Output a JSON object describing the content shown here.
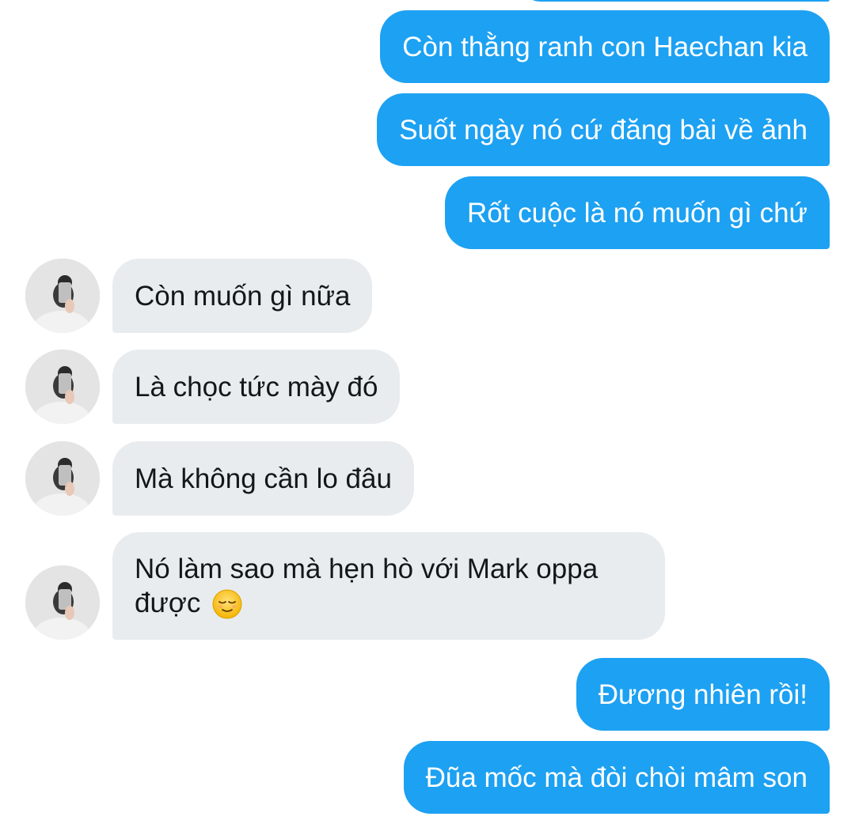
{
  "conversation": {
    "sent": [
      {
        "text": "Còn thằng ranh con Haechan kia"
      },
      {
        "text": "Suốt ngày nó cứ đăng bài về ảnh"
      },
      {
        "text": "Rốt cuộc là nó muốn gì chứ"
      },
      {
        "text": "Đương nhiên rồi!"
      },
      {
        "text": "Đũa mốc mà đòi chòi mâm son"
      }
    ],
    "received": [
      {
        "text": "Còn muốn gì nữa"
      },
      {
        "text": "Là chọc tức mày đó"
      },
      {
        "text": "Mà không cần lo đâu"
      },
      {
        "line1": "Nó làm sao mà hẹn hò với Mark oppa",
        "line2": "được",
        "emoji": "relieved-face-emoji"
      }
    ]
  },
  "colors": {
    "sent_bubble": "#1da1f2",
    "received_bubble": "#e8ecef",
    "received_text": "#14171a",
    "sent_text": "#ffffff"
  }
}
